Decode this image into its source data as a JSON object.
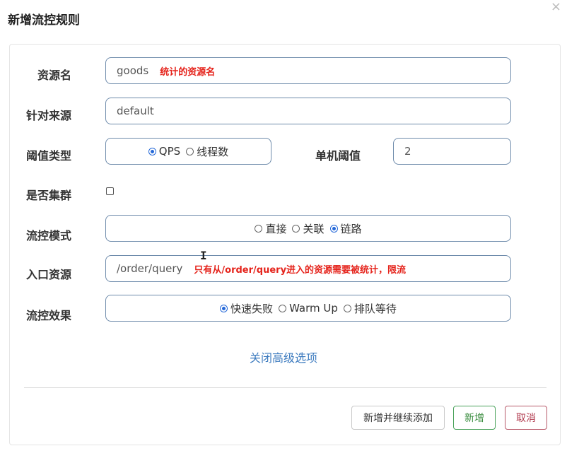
{
  "dialog": {
    "title": "新增流控规则",
    "close_icon": "×"
  },
  "form": {
    "resource_name": {
      "label": "资源名",
      "value": "goods",
      "hint": "统计的资源名"
    },
    "limit_app": {
      "label": "针对来源",
      "value": "default"
    },
    "threshold_type": {
      "label": "阈值类型",
      "options": [
        {
          "label": "QPS",
          "selected": true
        },
        {
          "label": "线程数",
          "selected": false
        }
      ]
    },
    "single_threshold": {
      "label": "单机阈值",
      "value": "2"
    },
    "cluster": {
      "label": "是否集群",
      "checked": false
    },
    "flow_mode": {
      "label": "流控模式",
      "options": [
        {
          "label": "直接",
          "selected": false
        },
        {
          "label": "关联",
          "selected": false
        },
        {
          "label": "链路",
          "selected": true
        }
      ]
    },
    "entry_resource": {
      "label": "入口资源",
      "value": "/order/query",
      "hint": "只有从/order/query进入的资源需要被统计，限流"
    },
    "control_effect": {
      "label": "流控效果",
      "options": [
        {
          "label": "快速失败",
          "selected": true
        },
        {
          "label": "Warm Up",
          "selected": false
        },
        {
          "label": "排队等待",
          "selected": false
        }
      ]
    }
  },
  "advanced_toggle": "关闭高级选项",
  "buttons": {
    "add_continue": "新增并继续添加",
    "add": "新增",
    "cancel": "取消"
  },
  "colors": {
    "hint_red": "#e5231b",
    "link_blue": "#3d7bbf",
    "radio_blue": "#2468d8",
    "add_green": "#49a25a",
    "cancel_red": "#b85a6a"
  }
}
